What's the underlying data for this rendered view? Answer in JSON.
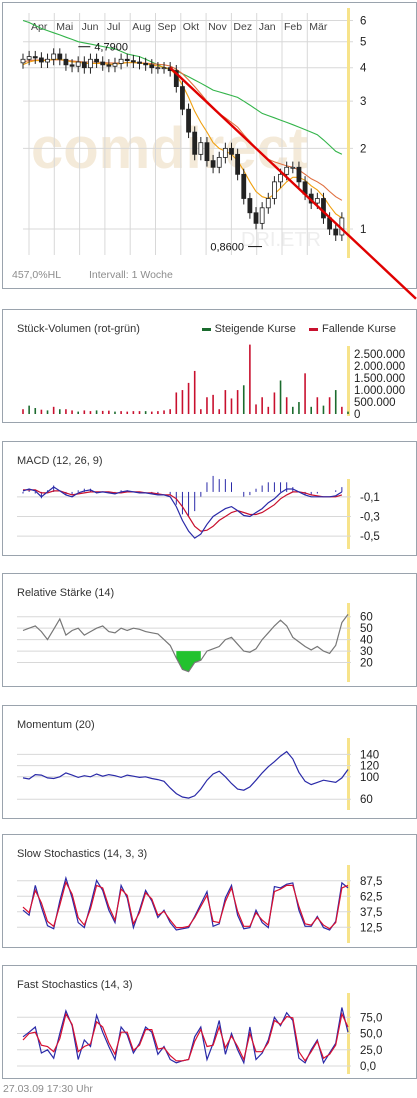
{
  "main": {
    "months": [
      "Apr",
      "Mai",
      "Jun",
      "Jul",
      "Aug",
      "Sep",
      "Okt",
      "Nov",
      "Dez",
      "Jan",
      "Feb",
      "Mär"
    ],
    "yticks": [
      "6",
      "5",
      "4",
      "3",
      "2",
      "1"
    ],
    "yticks_num": [
      6,
      5,
      4,
      3,
      2,
      1
    ],
    "high_label": "4,7900",
    "low_label": "0,8600",
    "range_text": "457,0%HL",
    "interval_text": "Intervall: 1 Woche",
    "watermark": "comdirect",
    "watermark_symbol": "DRI.ETR"
  },
  "volume": {
    "title": "Stück-Volumen (rot-grün)",
    "legend_up": "Steigende Kurse",
    "legend_down": "Fallende Kurse",
    "ticks": [
      "2.500.000",
      "2.000.000",
      "1.500.000",
      "1.000.000",
      "500.000",
      "0"
    ]
  },
  "macd": {
    "title": "MACD (12, 26, 9)",
    "ticks": [
      "-0,1",
      "-0,3",
      "-0,5"
    ]
  },
  "rsi": {
    "title": "Relative Stärke (14)",
    "ticks": [
      "60",
      "50",
      "40",
      "30",
      "20"
    ]
  },
  "momentum": {
    "title": "Momentum (20)",
    "ticks": [
      "140",
      "120",
      "100",
      "60"
    ]
  },
  "slow": {
    "title": "Slow Stochastics (14, 3, 3)",
    "ticks": [
      "87,5",
      "62,5",
      "37,5",
      "12,5"
    ]
  },
  "fast": {
    "title": "Fast Stochastics (14, 3)",
    "ticks": [
      "75,0",
      "50,0",
      "25,0",
      "0,0"
    ]
  },
  "footer": {
    "timestamp": "27.03.09 17:30 Uhr"
  },
  "colors": {
    "up": "#1b6b2e",
    "down": "#c8102e",
    "trend": "#e00000",
    "ma_short": "#f0a010",
    "ma_mid": "#e07040",
    "ma_long": "#33b44a",
    "line_blue": "#2a2aa8",
    "highlight": "#f7e38a"
  },
  "chart_data": [
    {
      "type": "candlestick",
      "title": "",
      "x_unit": "week",
      "x_months": [
        "Apr",
        "Mai",
        "Jun",
        "Jul",
        "Aug",
        "Sep",
        "Okt",
        "Nov",
        "Dez",
        "Jan",
        "Feb",
        "Mär"
      ],
      "y_scale": "log",
      "ylim": [
        0.8,
        6.4
      ],
      "annotations": [
        {
          "text": "4,7900",
          "value": 4.79
        },
        {
          "text": "0,8600",
          "value": 0.86
        }
      ],
      "series": [
        {
          "name": "close",
          "values": [
            4.3,
            4.4,
            4.35,
            4.2,
            4.3,
            4.5,
            4.3,
            4.1,
            4.05,
            4.2,
            4.0,
            4.3,
            4.2,
            4.1,
            4.05,
            4.15,
            4.3,
            4.25,
            4.2,
            4.15,
            4.1,
            4.0,
            4.0,
            4.0,
            3.9,
            3.4,
            2.8,
            2.3,
            1.9,
            2.1,
            1.8,
            1.7,
            1.85,
            2.0,
            1.9,
            1.6,
            1.3,
            1.15,
            1.05,
            1.2,
            1.3,
            1.5,
            1.6,
            1.7,
            1.7,
            1.5,
            1.35,
            1.25,
            1.3,
            1.1,
            1.0,
            0.95,
            1.1
          ]
        },
        {
          "name": "sma_short",
          "values": [
            4.1,
            4.2,
            4.25,
            4.25,
            4.25,
            4.3,
            4.3,
            4.25,
            4.2,
            4.2,
            4.15,
            4.15,
            4.15,
            4.15,
            4.12,
            4.12,
            4.15,
            4.18,
            4.18,
            4.16,
            4.14,
            4.1,
            4.06,
            4.02,
            3.95,
            3.75,
            3.45,
            3.1,
            2.75,
            2.5,
            2.3,
            2.1,
            2.0,
            1.95,
            1.9,
            1.8,
            1.65,
            1.5,
            1.38,
            1.32,
            1.3,
            1.35,
            1.42,
            1.5,
            1.56,
            1.56,
            1.52,
            1.45,
            1.4,
            1.32,
            1.22,
            1.14,
            1.1
          ]
        },
        {
          "name": "sma_mid",
          "values": [
            4.2,
            4.25,
            4.27,
            4.27,
            4.27,
            4.28,
            4.28,
            4.26,
            4.24,
            4.22,
            4.2,
            4.2,
            4.2,
            4.18,
            4.17,
            4.16,
            4.17,
            4.18,
            4.18,
            4.17,
            4.16,
            4.14,
            4.12,
            4.1,
            4.06,
            3.95,
            3.8,
            3.6,
            3.4,
            3.2,
            3.0,
            2.85,
            2.7,
            2.6,
            2.5,
            2.4,
            2.25,
            2.12,
            2.0,
            1.9,
            1.82,
            1.78,
            1.75,
            1.72,
            1.7,
            1.66,
            1.6,
            1.54,
            1.5,
            1.45,
            1.38,
            1.32,
            1.28
          ]
        },
        {
          "name": "sma_long",
          "values": [
            6.0,
            5.9,
            5.75,
            5.6,
            5.5,
            5.4,
            5.3,
            5.2,
            5.1,
            5.0,
            4.95,
            4.9,
            4.85,
            4.8,
            4.75,
            4.7,
            4.6,
            4.5,
            4.45,
            4.4,
            4.3,
            4.2,
            4.1,
            4.0,
            3.95,
            3.9,
            3.8,
            3.7,
            3.6,
            3.5,
            3.4,
            3.3,
            3.25,
            3.2,
            3.15,
            3.1,
            3.0,
            2.9,
            2.8,
            2.7,
            2.65,
            2.6,
            2.55,
            2.5,
            2.45,
            2.4,
            2.35,
            2.3,
            2.25,
            2.15,
            2.05,
            1.95,
            1.9
          ]
        },
        {
          "name": "trendline",
          "points": [
            [
              24,
              4.0
            ],
            [
              52,
              1.0
            ]
          ]
        }
      ]
    },
    {
      "type": "bar",
      "title": "Stück-Volumen (rot-grün)",
      "ylim": [
        0,
        2800000
      ],
      "series": [
        {
          "name": "Steigende Kurse",
          "values": [
            0,
            350000,
            250000,
            0,
            150000,
            0,
            200000,
            0,
            0,
            100000,
            0,
            0,
            150000,
            0,
            0,
            100000,
            0,
            0,
            0,
            0,
            120000,
            0,
            0,
            0,
            0,
            0,
            0,
            0,
            0,
            0,
            0,
            0,
            0,
            0,
            0,
            0,
            1200000,
            0,
            0,
            0,
            0,
            0,
            1400000,
            0,
            300000,
            500000,
            0,
            300000,
            0,
            350000,
            0,
            1000000,
            0,
            100000,
            1900000
          ]
        },
        {
          "name": "Fallende Kurse",
          "values": [
            200000,
            0,
            0,
            180000,
            0,
            300000,
            0,
            200000,
            150000,
            0,
            150000,
            120000,
            0,
            130000,
            140000,
            0,
            120000,
            100000,
            120000,
            120000,
            0,
            100000,
            120000,
            150000,
            200000,
            900000,
            1000000,
            1300000,
            1800000,
            200000,
            700000,
            800000,
            200000,
            1000000,
            650000,
            1000000,
            0,
            2900000,
            400000,
            700000,
            300000,
            900000,
            0,
            700000,
            0,
            0,
            1700000,
            0,
            700000,
            0,
            700000,
            0,
            300000,
            0,
            0
          ]
        }
      ]
    },
    {
      "type": "line",
      "title": "MACD (12, 26, 9)",
      "ylim": [
        -0.56,
        0.0
      ],
      "series": [
        {
          "name": "macd",
          "values": [
            -0.04,
            -0.02,
            -0.04,
            -0.1,
            -0.05,
            -0.0,
            -0.04,
            -0.08,
            -0.1,
            -0.06,
            -0.04,
            -0.03,
            -0.06,
            -0.05,
            -0.06,
            -0.07,
            -0.05,
            -0.04,
            -0.05,
            -0.06,
            -0.06,
            -0.07,
            -0.08,
            -0.08,
            -0.1,
            -0.2,
            -0.34,
            -0.45,
            -0.52,
            -0.48,
            -0.38,
            -0.3,
            -0.26,
            -0.22,
            -0.2,
            -0.24,
            -0.29,
            -0.3,
            -0.26,
            -0.22,
            -0.16,
            -0.12,
            -0.06,
            -0.02,
            -0.02,
            -0.05,
            -0.08,
            -0.1,
            -0.1,
            -0.1,
            -0.1,
            -0.09,
            -0.05
          ]
        },
        {
          "name": "signal",
          "values": [
            -0.03,
            -0.03,
            -0.03,
            -0.06,
            -0.06,
            -0.04,
            -0.04,
            -0.06,
            -0.08,
            -0.07,
            -0.06,
            -0.05,
            -0.05,
            -0.05,
            -0.05,
            -0.06,
            -0.06,
            -0.05,
            -0.05,
            -0.05,
            -0.06,
            -0.06,
            -0.07,
            -0.08,
            -0.08,
            -0.12,
            -0.2,
            -0.3,
            -0.4,
            -0.45,
            -0.44,
            -0.4,
            -0.34,
            -0.3,
            -0.26,
            -0.24,
            -0.26,
            -0.28,
            -0.28,
            -0.26,
            -0.22,
            -0.18,
            -0.12,
            -0.08,
            -0.05,
            -0.05,
            -0.06,
            -0.08,
            -0.09,
            -0.1,
            -0.1,
            -0.1,
            -0.08
          ]
        }
      ]
    },
    {
      "type": "line",
      "title": "Relative Stärke (14)",
      "ylim": [
        10,
        65
      ],
      "series": [
        {
          "name": "rsi",
          "values": [
            48,
            50,
            52,
            47,
            40,
            49,
            58,
            44,
            48,
            50,
            44,
            47,
            50,
            52,
            47,
            46,
            50,
            48,
            50,
            49,
            47,
            46,
            45,
            40,
            35,
            24,
            14,
            12,
            20,
            22,
            30,
            32,
            34,
            40,
            42,
            36,
            30,
            29,
            32,
            40,
            46,
            52,
            57,
            52,
            42,
            38,
            34,
            31,
            34,
            30,
            28,
            35,
            55,
            62
          ]
        }
      ]
    },
    {
      "type": "line",
      "title": "Momentum (20)",
      "ylim": [
        55,
        155
      ],
      "series": [
        {
          "name": "momentum",
          "values": [
            98,
            96,
            104,
            103,
            98,
            97,
            100,
            107,
            103,
            99,
            102,
            100,
            105,
            101,
            104,
            102,
            99,
            103,
            101,
            99,
            100,
            97,
            95,
            92,
            80,
            70,
            64,
            62,
            66,
            78,
            94,
            105,
            110,
            100,
            88,
            78,
            76,
            82,
            94,
            107,
            118,
            127,
            137,
            145,
            132,
            108,
            92,
            86,
            90,
            94,
            92,
            90,
            98,
            113
          ]
        }
      ]
    },
    {
      "type": "line",
      "title": "Slow Stochastics (14, 3, 3)",
      "ylim": [
        0,
        100
      ],
      "series": [
        {
          "name": "%K",
          "values": [
            40,
            32,
            80,
            45,
            15,
            10,
            55,
            92,
            60,
            20,
            12,
            48,
            88,
            72,
            40,
            20,
            80,
            60,
            12,
            40,
            72,
            55,
            28,
            40,
            20,
            8,
            10,
            12,
            30,
            50,
            70,
            14,
            18,
            60,
            80,
            32,
            10,
            12,
            40,
            20,
            12,
            78,
            76,
            82,
            84,
            40,
            14,
            14,
            30,
            12,
            8,
            22,
            84,
            76
          ]
        },
        {
          "name": "%D",
          "values": [
            45,
            36,
            72,
            52,
            22,
            14,
            48,
            85,
            66,
            28,
            16,
            42,
            80,
            76,
            46,
            24,
            74,
            64,
            18,
            36,
            68,
            58,
            32,
            38,
            24,
            12,
            12,
            14,
            28,
            46,
            64,
            22,
            20,
            54,
            76,
            38,
            14,
            14,
            36,
            24,
            16,
            70,
            74,
            80,
            80,
            46,
            18,
            16,
            28,
            16,
            10,
            20,
            76,
            80
          ]
        }
      ]
    },
    {
      "type": "line",
      "title": "Fast Stochastics (14, 3)",
      "ylim": [
        0,
        100
      ],
      "series": [
        {
          "name": "%K",
          "values": [
            45,
            52,
            60,
            20,
            25,
            12,
            50,
            85,
            62,
            10,
            40,
            30,
            78,
            52,
            30,
            10,
            60,
            48,
            20,
            35,
            60,
            52,
            18,
            30,
            10,
            5,
            8,
            10,
            45,
            60,
            10,
            35,
            70,
            18,
            50,
            25,
            5,
            60,
            10,
            20,
            40,
            75,
            62,
            82,
            70,
            12,
            5,
            25,
            40,
            5,
            20,
            35,
            90,
            52
          ]
        },
        {
          "name": "%D",
          "values": [
            40,
            50,
            52,
            32,
            30,
            22,
            42,
            80,
            64,
            22,
            30,
            34,
            68,
            60,
            36,
            18,
            52,
            52,
            24,
            32,
            56,
            56,
            26,
            28,
            16,
            8,
            8,
            10,
            38,
            56,
            30,
            32,
            60,
            28,
            46,
            30,
            10,
            50,
            22,
            22,
            36,
            70,
            64,
            76,
            74,
            22,
            8,
            22,
            38,
            12,
            18,
            32,
            80,
            60
          ]
        }
      ]
    }
  ]
}
